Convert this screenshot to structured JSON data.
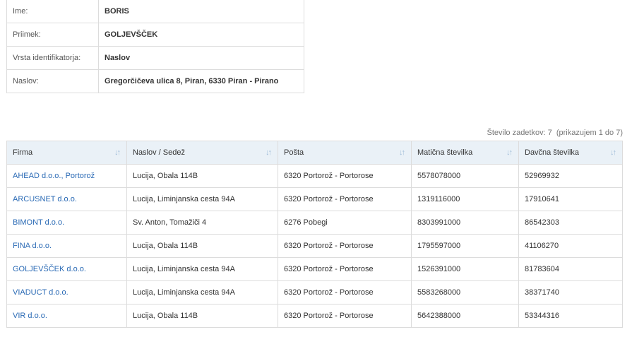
{
  "person": {
    "rows": [
      {
        "label": "Ime:",
        "value": "BORIS"
      },
      {
        "label": "Priimek:",
        "value": "GOLJEVŠČEK"
      },
      {
        "label": "Vrsta identifikatorja:",
        "value": "Naslov"
      },
      {
        "label": "Naslov:",
        "value": "Gregorčičeva ulica 8, Piran, 6330 Piran - Pirano"
      }
    ]
  },
  "results": {
    "count_text": "Število zadetkov: 7",
    "range_text": "(prikazujem 1 do 7)",
    "columns": [
      "Firma",
      "Naslov / Sedež",
      "Pošta",
      "Matična številka",
      "Davčna številka"
    ],
    "sort_icon": "sort-icon",
    "link_color": "#2a6ab5",
    "header_bg": "#eaf1f7",
    "rows": [
      [
        "AHEAD d.o.o., Portorož",
        "Lucija, Obala 114B",
        "6320 Portorož - Portorose",
        "5578078000",
        "52969932"
      ],
      [
        "ARCUSNET d.o.o.",
        "Lucija, Liminjanska cesta 94A",
        "6320 Portorož - Portorose",
        "1319116000",
        "17910641"
      ],
      [
        "BIMONT d.o.o.",
        "Sv. Anton, Tomažiči 4",
        "6276 Pobegi",
        "8303991000",
        "86542303"
      ],
      [
        "FINA d.o.o.",
        "Lucija, Obala 114B",
        "6320 Portorož - Portorose",
        "1795597000",
        "41106270"
      ],
      [
        "GOLJEVŠČEK d.o.o.",
        "Lucija, Liminjanska cesta 94A",
        "6320 Portorož - Portorose",
        "1526391000",
        "81783604"
      ],
      [
        "VIADUCT d.o.o.",
        "Lucija, Liminjanska cesta 94A",
        "6320 Portorož - Portorose",
        "5583268000",
        "38371740"
      ],
      [
        "VIR d.o.o.",
        "Lucija, Obala 114B",
        "6320 Portorož - Portorose",
        "5642388000",
        "53344316"
      ]
    ]
  }
}
